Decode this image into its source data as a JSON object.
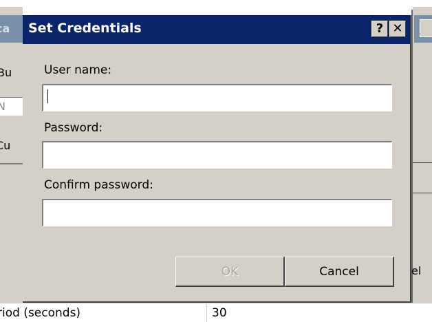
{
  "background": {
    "left_title_fragment": "ca",
    "left_text_1": "Bu",
    "left_input_fragment": "N",
    "left_text_2": "Cu",
    "right_text": "el",
    "bottom_label": "riod (seconds)",
    "bottom_value": "30"
  },
  "dialog": {
    "title": "Set Credentials",
    "help_button_glyph": "?",
    "close_button_glyph": "✕",
    "fields": {
      "username": {
        "label": "User name:",
        "value": "",
        "placeholder": ""
      },
      "password": {
        "label": "Password:",
        "value": "",
        "placeholder": ""
      },
      "confirm_password": {
        "label": "Confirm password:",
        "value": "",
        "placeholder": ""
      }
    },
    "buttons": {
      "ok": {
        "label": "OK",
        "enabled": false
      },
      "cancel": {
        "label": "Cancel",
        "enabled": true
      }
    }
  },
  "colors": {
    "titlebar": "#0a246a",
    "face": "#d4d0c8",
    "title_text": "#ffffff"
  }
}
